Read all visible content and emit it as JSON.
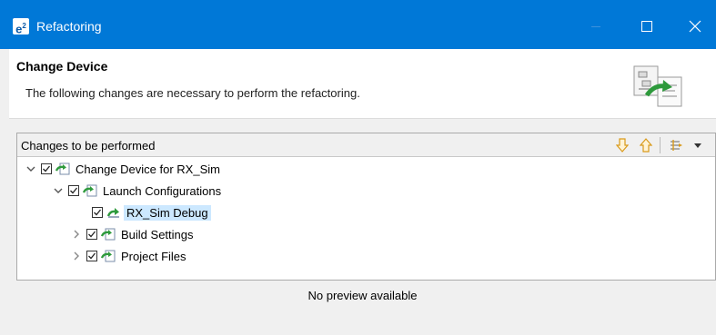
{
  "window": {
    "title": "Refactoring",
    "logo_text": "e²"
  },
  "header": {
    "title": "Change Device",
    "description": "The following changes are necessary to perform the refactoring."
  },
  "changes_panel": {
    "title": "Changes to be performed",
    "toolbar": {
      "next_change_icon": "arrow-down-icon",
      "previous_change_icon": "arrow-up-icon",
      "filter_icon": "filter-changes-icon",
      "menu_icon": "view-menu-icon"
    },
    "tree": {
      "root": {
        "label": "Change Device for RX_Sim",
        "checked": true,
        "expanded": true
      },
      "launch_configurations": {
        "label": "Launch Configurations",
        "checked": true,
        "expanded": true
      },
      "rx_sim_debug": {
        "label": "RX_Sim Debug",
        "checked": true,
        "selected": true
      },
      "build_settings": {
        "label": "Build Settings",
        "checked": true,
        "expanded": false
      },
      "project_files": {
        "label": "Project Files",
        "checked": true,
        "expanded": false
      }
    }
  },
  "preview": {
    "message": "No preview available"
  },
  "colors": {
    "titlebar": "#0078d7",
    "selection": "#cce8ff",
    "toolbar_arrow": "#e8a317"
  }
}
